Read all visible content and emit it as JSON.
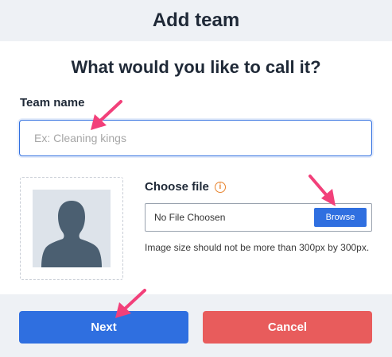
{
  "header": {
    "title": "Add team"
  },
  "form": {
    "question": "What would you like to call it?",
    "team_name_label": "Team name",
    "team_name_value": "",
    "team_name_placeholder": "Ex: Cleaning kings"
  },
  "file": {
    "choose_label": "Choose file",
    "info_icon": "info-icon",
    "status_text": "No File Choosen",
    "browse_label": "Browse",
    "hint": "Image size should not be more than 300px by 300px."
  },
  "avatar": {
    "icon": "person-silhouette"
  },
  "actions": {
    "next_label": "Next",
    "cancel_label": "Cancel"
  },
  "colors": {
    "primary": "#2f6fe0",
    "danger": "#e85c5c",
    "annotation_arrow": "#f2407a",
    "panel_bg": "#eef1f5"
  }
}
